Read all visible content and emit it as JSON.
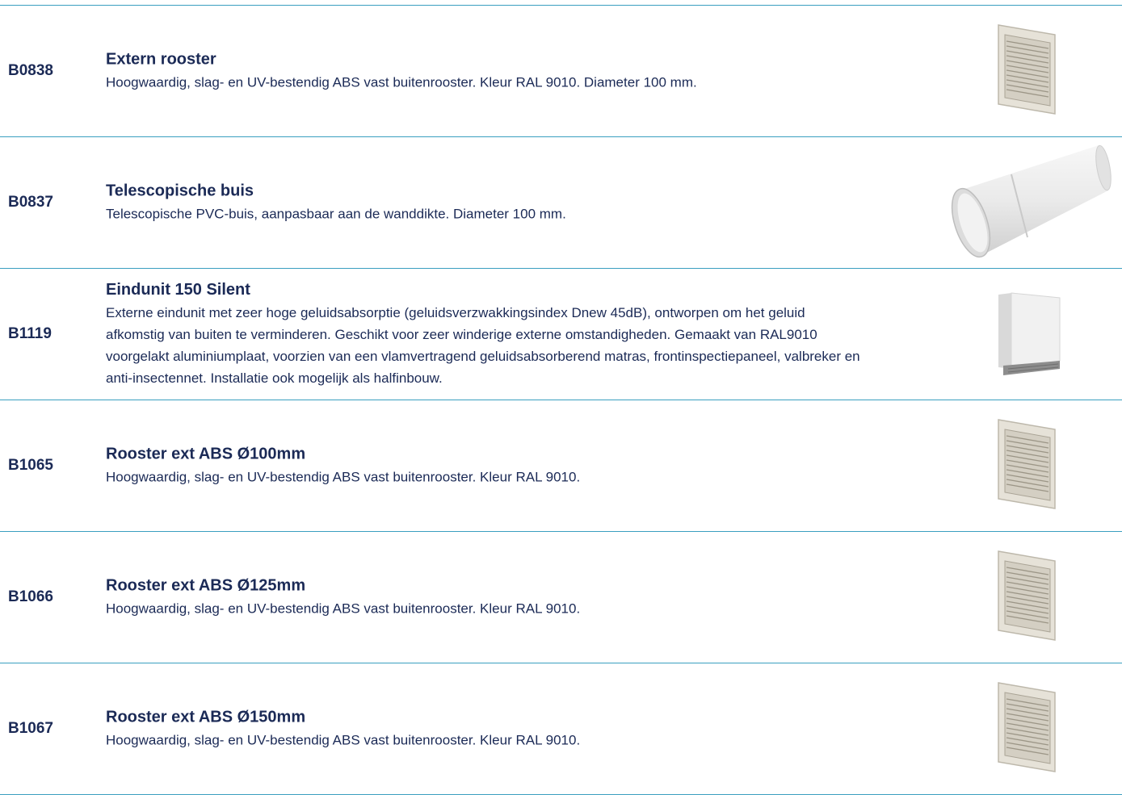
{
  "products": [
    {
      "code": "B0838",
      "title": "Extern rooster",
      "description": "Hoogwaardig, slag- en UV-bestendig ABS vast buitenrooster. Kleur RAL 9010. Diameter 100 mm.",
      "image_icon": "grille-icon"
    },
    {
      "code": "B0837",
      "title": "Telescopische buis",
      "description": "Telescopische PVC-buis, aanpasbaar aan de wanddikte. Diameter 100 mm.",
      "image_icon": "pipe-icon"
    },
    {
      "code": "B1119",
      "title": "Eindunit 150 Silent",
      "description": "Externe eindunit met zeer hoge geluidsabsorptie (geluidsverzwakkingsindex Dnew 45dB), ontworpen om het geluid afkomstig van buiten te verminderen. Geschikt voor zeer winderige externe omstandigheden. Gemaakt van RAL9010 voorgelakt aluminiumplaat, voorzien van een vlamvertragend geluidsabsorberend matras, frontinspectiepaneel, valbreker en anti-insectennet. Installatie ook mogelijk als halfinbouw.",
      "image_icon": "hood-icon"
    },
    {
      "code": "B1065",
      "title": "Rooster ext ABS Ø100mm",
      "description": "Hoogwaardig, slag- en UV-bestendig ABS vast buitenrooster. Kleur RAL 9010.",
      "image_icon": "grille-icon"
    },
    {
      "code": "B1066",
      "title": "Rooster ext ABS Ø125mm",
      "description": "Hoogwaardig, slag- en UV-bestendig ABS vast buitenrooster. Kleur RAL 9010.",
      "image_icon": "grille-icon"
    },
    {
      "code": "B1067",
      "title": "Rooster ext ABS Ø150mm",
      "description": "Hoogwaardig, slag- en UV-bestendig ABS vast buitenrooster. Kleur RAL 9010.",
      "image_icon": "grille-icon"
    }
  ],
  "colors": {
    "text": "#1b2a56",
    "divider": "#3a9fc0"
  }
}
